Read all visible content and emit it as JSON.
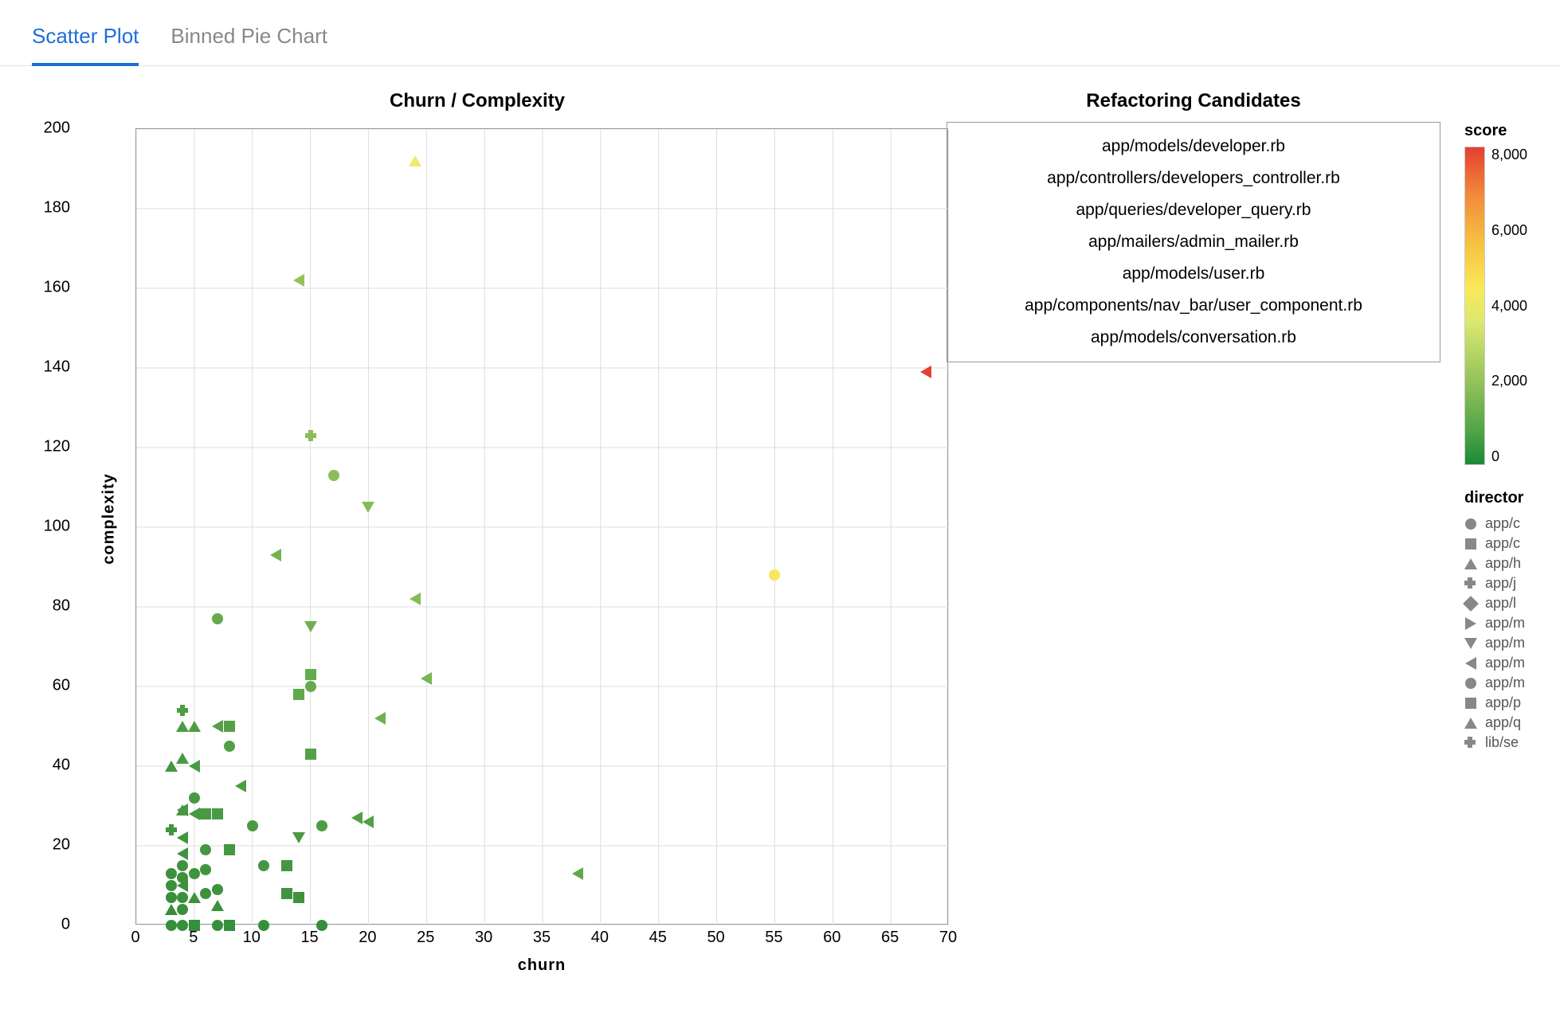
{
  "tabs": [
    {
      "id": "scatter",
      "label": "Scatter Plot",
      "active": true
    },
    {
      "id": "binned",
      "label": "Binned Pie Chart",
      "active": false
    }
  ],
  "chart_data": {
    "type": "scatter",
    "title": "Churn / Complexity",
    "xlabel": "churn",
    "ylabel": "complexity",
    "xlim": [
      0,
      70
    ],
    "ylim": [
      0,
      200
    ],
    "xticks": [
      0,
      5,
      10,
      15,
      20,
      25,
      30,
      35,
      40,
      45,
      50,
      55,
      60,
      65,
      70
    ],
    "yticks": [
      0,
      20,
      40,
      60,
      80,
      100,
      120,
      140,
      160,
      180,
      200
    ],
    "color_scale": {
      "label": "score",
      "min": 0,
      "max": 9000,
      "ticks": [
        0,
        2000,
        4000,
        6000,
        8000
      ]
    },
    "shape_legend": {
      "label": "director",
      "items": [
        {
          "shape": "circle",
          "label": "app/c"
        },
        {
          "shape": "square",
          "label": "app/c"
        },
        {
          "shape": "tri-up",
          "label": "app/h"
        },
        {
          "shape": "cross",
          "label": "app/j"
        },
        {
          "shape": "diamond",
          "label": "app/l"
        },
        {
          "shape": "tri-right",
          "label": "app/m"
        },
        {
          "shape": "tri-down",
          "label": "app/m"
        },
        {
          "shape": "tri-left",
          "label": "app/m"
        },
        {
          "shape": "circle",
          "label": "app/m"
        },
        {
          "shape": "square",
          "label": "app/p"
        },
        {
          "shape": "tri-up",
          "label": "app/q"
        },
        {
          "shape": "cross",
          "label": "lib/se"
        }
      ]
    },
    "series": [
      {
        "x": 68,
        "y": 139,
        "shape": "tri-left",
        "color": "#e34030"
      },
      {
        "x": 55,
        "y": 88,
        "shape": "circle",
        "color": "#f5e85a"
      },
      {
        "x": 24,
        "y": 192,
        "shape": "tri-up",
        "color": "#f2e96a"
      },
      {
        "x": 38,
        "y": 13,
        "shape": "tri-left",
        "color": "#5fa84c"
      },
      {
        "x": 25,
        "y": 62,
        "shape": "tri-left",
        "color": "#7ab554"
      },
      {
        "x": 24,
        "y": 82,
        "shape": "tri-left",
        "color": "#86bc58"
      },
      {
        "x": 21,
        "y": 52,
        "shape": "tri-left",
        "color": "#6fb051"
      },
      {
        "x": 20,
        "y": 26,
        "shape": "tri-left",
        "color": "#529f46"
      },
      {
        "x": 19,
        "y": 27,
        "shape": "tri-left",
        "color": "#529f46"
      },
      {
        "x": 15,
        "y": 123,
        "shape": "cross",
        "color": "#8abd58"
      },
      {
        "x": 14,
        "y": 162,
        "shape": "tri-left",
        "color": "#93c25c"
      },
      {
        "x": 20,
        "y": 105,
        "shape": "tri-down",
        "color": "#86bc58"
      },
      {
        "x": 17,
        "y": 113,
        "shape": "circle",
        "color": "#8abd58"
      },
      {
        "x": 15,
        "y": 75,
        "shape": "tri-down",
        "color": "#6fb051"
      },
      {
        "x": 15,
        "y": 60,
        "shape": "circle",
        "color": "#65ab4e"
      },
      {
        "x": 15,
        "y": 63,
        "shape": "square",
        "color": "#65ab4e"
      },
      {
        "x": 14,
        "y": 58,
        "shape": "square",
        "color": "#5fa84c"
      },
      {
        "x": 15,
        "y": 43,
        "shape": "square",
        "color": "#569f47"
      },
      {
        "x": 14,
        "y": 22,
        "shape": "tri-down",
        "color": "#4a9a43"
      },
      {
        "x": 13,
        "y": 15,
        "shape": "square",
        "color": "#459741"
      },
      {
        "x": 13,
        "y": 8,
        "shape": "square",
        "color": "#3f933e"
      },
      {
        "x": 14,
        "y": 7,
        "shape": "square",
        "color": "#3f933e"
      },
      {
        "x": 12,
        "y": 93,
        "shape": "tri-left",
        "color": "#74b252"
      },
      {
        "x": 9,
        "y": 35,
        "shape": "tri-left",
        "color": "#4e9c45"
      },
      {
        "x": 10,
        "y": 25,
        "shape": "circle",
        "color": "#4a9a43"
      },
      {
        "x": 11,
        "y": 0,
        "shape": "circle",
        "color": "#368f3a"
      },
      {
        "x": 16,
        "y": 25,
        "shape": "circle",
        "color": "#4e9c45"
      },
      {
        "x": 11,
        "y": 15,
        "shape": "circle",
        "color": "#459741"
      },
      {
        "x": 16,
        "y": 0,
        "shape": "circle",
        "color": "#368f3a"
      },
      {
        "x": 8,
        "y": 19,
        "shape": "square",
        "color": "#459741"
      },
      {
        "x": 8,
        "y": 45,
        "shape": "circle",
        "color": "#529f46"
      },
      {
        "x": 7,
        "y": 50,
        "shape": "tri-left",
        "color": "#569f47"
      },
      {
        "x": 7,
        "y": 77,
        "shape": "circle",
        "color": "#65ab4e"
      },
      {
        "x": 8,
        "y": 50,
        "shape": "square",
        "color": "#569f47"
      },
      {
        "x": 7,
        "y": 28,
        "shape": "square",
        "color": "#4a9a43"
      },
      {
        "x": 6,
        "y": 28,
        "shape": "square",
        "color": "#4a9a43"
      },
      {
        "x": 6,
        "y": 19,
        "shape": "circle",
        "color": "#459741"
      },
      {
        "x": 6,
        "y": 14,
        "shape": "circle",
        "color": "#41953f"
      },
      {
        "x": 7,
        "y": 9,
        "shape": "circle",
        "color": "#3f933e"
      },
      {
        "x": 6,
        "y": 8,
        "shape": "circle",
        "color": "#3d913d"
      },
      {
        "x": 5,
        "y": 50,
        "shape": "tri-up",
        "color": "#4e9c45"
      },
      {
        "x": 5,
        "y": 40,
        "shape": "tri-left",
        "color": "#4a9a43"
      },
      {
        "x": 5,
        "y": 32,
        "shape": "circle",
        "color": "#489942"
      },
      {
        "x": 5,
        "y": 28,
        "shape": "tri-left",
        "color": "#489942"
      },
      {
        "x": 5,
        "y": 13,
        "shape": "circle",
        "color": "#3f933e"
      },
      {
        "x": 5,
        "y": 7,
        "shape": "tri-up",
        "color": "#3d913d"
      },
      {
        "x": 5,
        "y": 0,
        "shape": "square",
        "color": "#368f3a"
      },
      {
        "x": 4,
        "y": 54,
        "shape": "cross",
        "color": "#4e9c45"
      },
      {
        "x": 4,
        "y": 50,
        "shape": "tri-up",
        "color": "#4c9b44"
      },
      {
        "x": 4,
        "y": 42,
        "shape": "tri-up",
        "color": "#4a9a43"
      },
      {
        "x": 4,
        "y": 29,
        "shape": "tri-up",
        "color": "#459741"
      },
      {
        "x": 4,
        "y": 29,
        "shape": "tri-left",
        "color": "#459741"
      },
      {
        "x": 7,
        "y": 5,
        "shape": "tri-up",
        "color": "#3b903c"
      },
      {
        "x": 3,
        "y": 24,
        "shape": "cross",
        "color": "#41953f"
      },
      {
        "x": 3,
        "y": 40,
        "shape": "tri-up",
        "color": "#459741"
      },
      {
        "x": 4,
        "y": 22,
        "shape": "tri-left",
        "color": "#41953f"
      },
      {
        "x": 4,
        "y": 18,
        "shape": "tri-left",
        "color": "#3f933e"
      },
      {
        "x": 4,
        "y": 15,
        "shape": "circle",
        "color": "#3f933e"
      },
      {
        "x": 4,
        "y": 12,
        "shape": "circle",
        "color": "#3d913d"
      },
      {
        "x": 4,
        "y": 10,
        "shape": "tri-left",
        "color": "#3d913d"
      },
      {
        "x": 4,
        "y": 7,
        "shape": "circle",
        "color": "#3b903c"
      },
      {
        "x": 4,
        "y": 4,
        "shape": "circle",
        "color": "#398e3b"
      },
      {
        "x": 4,
        "y": 0,
        "shape": "circle",
        "color": "#368f3a"
      },
      {
        "x": 3,
        "y": 13,
        "shape": "circle",
        "color": "#3d913d"
      },
      {
        "x": 3,
        "y": 10,
        "shape": "circle",
        "color": "#3b903c"
      },
      {
        "x": 3,
        "y": 7,
        "shape": "circle",
        "color": "#398e3b"
      },
      {
        "x": 3,
        "y": 4,
        "shape": "tri-up",
        "color": "#388d3b"
      },
      {
        "x": 3,
        "y": 0,
        "shape": "circle",
        "color": "#368f3a"
      },
      {
        "x": 7,
        "y": 0,
        "shape": "circle",
        "color": "#368f3a"
      },
      {
        "x": 8,
        "y": 0,
        "shape": "square",
        "color": "#368f3a"
      }
    ]
  },
  "candidates": {
    "title": "Refactoring Candidates",
    "items": [
      "app/models/developer.rb",
      "app/controllers/developers_controller.rb",
      "app/queries/developer_query.rb",
      "app/mailers/admin_mailer.rb",
      "app/models/user.rb",
      "app/components/nav_bar/user_component.rb",
      "app/models/conversation.rb"
    ]
  }
}
